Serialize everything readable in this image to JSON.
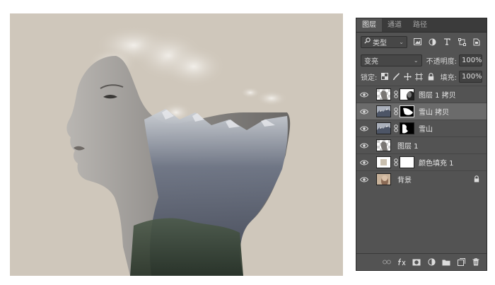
{
  "panel": {
    "tabs": [
      {
        "label": "图层",
        "active": true
      },
      {
        "label": "通道",
        "active": false
      },
      {
        "label": "路径",
        "active": false
      }
    ],
    "filter": {
      "kind_label": "类型",
      "icons": [
        "image-filter-icon",
        "adjustment-filter-icon",
        "type-filter-icon",
        "shape-filter-icon",
        "smart-object-filter-icon"
      ]
    },
    "blend_mode": "变亮",
    "opacity_label": "不透明度:",
    "opacity_value": "100%",
    "lock_label": "锁定:",
    "fill_label": "填充:",
    "fill_value": "100%",
    "layers": [
      {
        "name": "图层 1 拷贝",
        "visible": true,
        "has_mask": true,
        "selected": false
      },
      {
        "name": "雪山 拷贝",
        "visible": true,
        "has_mask": true,
        "selected": true
      },
      {
        "name": "雪山",
        "visible": true,
        "has_mask": true,
        "selected": false
      },
      {
        "name": "图层 1",
        "visible": true,
        "has_mask": false,
        "selected": false
      },
      {
        "name": "颜色填充 1",
        "visible": true,
        "has_mask": true,
        "selected": false
      },
      {
        "name": "背景",
        "visible": true,
        "has_mask": false,
        "selected": false,
        "locked": true
      }
    ],
    "footer_icons": [
      "link-layers-icon",
      "fx-icon",
      "add-mask-icon",
      "adjustment-layer-icon",
      "new-group-icon",
      "new-layer-icon",
      "delete-layer-icon"
    ]
  },
  "colors": {
    "canvas_bg": "#cfc7bb",
    "panel_bg": "#535353",
    "selected_row": "#6b6b6b"
  }
}
